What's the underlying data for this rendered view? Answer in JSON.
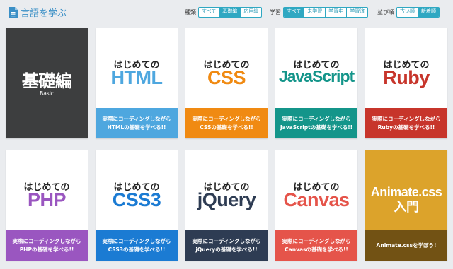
{
  "header": {
    "title": "言語を学ぶ",
    "icon": "document-icon"
  },
  "filters": {
    "type": {
      "label": "種類",
      "options": [
        "すべて",
        "基礎編",
        "応用編"
      ],
      "selected": 1
    },
    "learning": {
      "label": "学習",
      "options": [
        "すべて",
        "未学習",
        "学習中",
        "学習済"
      ],
      "selected": 0
    },
    "sort": {
      "label": "並び順",
      "options": [
        "古い順",
        "新着順"
      ],
      "selected": 1
    }
  },
  "colors": {
    "accent": "#2fa8c2",
    "background": "#eaecef"
  },
  "cards": [
    {
      "id": "basic",
      "title": "基礎編",
      "subtitle": "Basic",
      "bg": "#3d3e3f"
    },
    {
      "id": "html",
      "pre": "はじめての",
      "title": "HTML",
      "color": "#4ea7df",
      "band_line1": "実際にコーディングしながら",
      "band_line2": "HTMLの基礎を学べる!!"
    },
    {
      "id": "css",
      "pre": "はじめての",
      "title": "CSS",
      "color": "#f08a12",
      "band_line1": "実際にコーディングしながら",
      "band_line2": "CSSの基礎を学べる!!"
    },
    {
      "id": "javascript",
      "pre": "はじめての",
      "title": "JavaScript",
      "color": "#14958a",
      "band_line1": "実際にコーディングしながら",
      "band_line2": "JavaScriptの基礎を学べる!!"
    },
    {
      "id": "ruby",
      "pre": "はじめての",
      "title": "Ruby",
      "color": "#c7352b",
      "band_line1": "実際にコーディングしながら",
      "band_line2": "Rubyの基礎を学べる!!"
    },
    {
      "id": "php",
      "pre": "はじめての",
      "title": "PHP",
      "color": "#9a56c0",
      "band_line1": "実際にコーディングしながら",
      "band_line2": "PHPの基礎を学べる!!"
    },
    {
      "id": "css3",
      "pre": "はじめての",
      "title": "CSS3",
      "color": "#1b7bd3",
      "band_line1": "実際にコーディングしながら",
      "band_line2": "CSS3の基礎を学べる!!"
    },
    {
      "id": "jquery",
      "pre": "はじめての",
      "title": "jQuery",
      "color": "#2e3c53",
      "band_line1": "実際にコーディングしながら",
      "band_line2": "jQueryの基礎を学べる!!"
    },
    {
      "id": "canvas",
      "pre": "はじめての",
      "title": "Canvas",
      "color": "#e5544a",
      "band_line1": "実際にコーディングしながら",
      "band_line2": "Canvasの基礎を学べる!!"
    },
    {
      "id": "animate",
      "title_line1": "Animate.css",
      "title_line2": "入門",
      "band_line1": "Animate.cssを学ぼう!"
    }
  ]
}
